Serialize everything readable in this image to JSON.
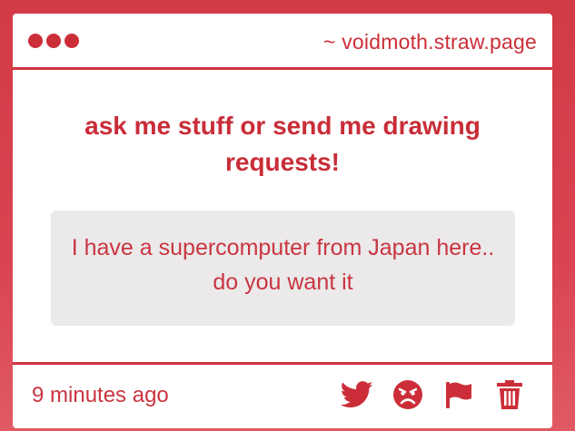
{
  "header": {
    "window_dots": 3,
    "domain": "~ voidmoth.straw.page"
  },
  "main": {
    "prompt": "ask me stuff or send me drawing requests!",
    "message": "I have a supercomputer from Japan here.. do you want it"
  },
  "footer": {
    "timestamp": "9 minutes ago",
    "actions": [
      {
        "icon": "twitter-icon",
        "name": "twitter-share-button"
      },
      {
        "icon": "angry-face-icon",
        "name": "block-button"
      },
      {
        "icon": "flag-icon",
        "name": "report-button"
      },
      {
        "icon": "trash-icon",
        "name": "delete-button"
      }
    ]
  },
  "colors": {
    "accent": "#cc2e39",
    "background": "#d23a45",
    "card": "#ffffff",
    "message_bg": "#ebe9ea"
  }
}
